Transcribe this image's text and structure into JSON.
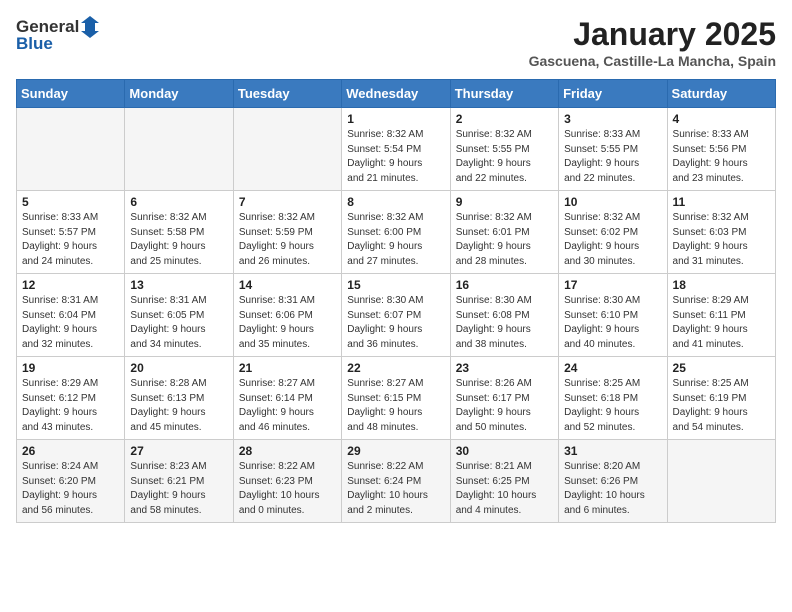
{
  "logo": {
    "text_general": "General",
    "text_blue": "Blue"
  },
  "title": {
    "month": "January 2025",
    "location": "Gascuena, Castille-La Mancha, Spain"
  },
  "headers": [
    "Sunday",
    "Monday",
    "Tuesday",
    "Wednesday",
    "Thursday",
    "Friday",
    "Saturday"
  ],
  "weeks": [
    [
      {
        "day": "",
        "info": ""
      },
      {
        "day": "",
        "info": ""
      },
      {
        "day": "",
        "info": ""
      },
      {
        "day": "1",
        "info": "Sunrise: 8:32 AM\nSunset: 5:54 PM\nDaylight: 9 hours\nand 21 minutes."
      },
      {
        "day": "2",
        "info": "Sunrise: 8:32 AM\nSunset: 5:55 PM\nDaylight: 9 hours\nand 22 minutes."
      },
      {
        "day": "3",
        "info": "Sunrise: 8:33 AM\nSunset: 5:55 PM\nDaylight: 9 hours\nand 22 minutes."
      },
      {
        "day": "4",
        "info": "Sunrise: 8:33 AM\nSunset: 5:56 PM\nDaylight: 9 hours\nand 23 minutes."
      }
    ],
    [
      {
        "day": "5",
        "info": "Sunrise: 8:33 AM\nSunset: 5:57 PM\nDaylight: 9 hours\nand 24 minutes."
      },
      {
        "day": "6",
        "info": "Sunrise: 8:32 AM\nSunset: 5:58 PM\nDaylight: 9 hours\nand 25 minutes."
      },
      {
        "day": "7",
        "info": "Sunrise: 8:32 AM\nSunset: 5:59 PM\nDaylight: 9 hours\nand 26 minutes."
      },
      {
        "day": "8",
        "info": "Sunrise: 8:32 AM\nSunset: 6:00 PM\nDaylight: 9 hours\nand 27 minutes."
      },
      {
        "day": "9",
        "info": "Sunrise: 8:32 AM\nSunset: 6:01 PM\nDaylight: 9 hours\nand 28 minutes."
      },
      {
        "day": "10",
        "info": "Sunrise: 8:32 AM\nSunset: 6:02 PM\nDaylight: 9 hours\nand 30 minutes."
      },
      {
        "day": "11",
        "info": "Sunrise: 8:32 AM\nSunset: 6:03 PM\nDaylight: 9 hours\nand 31 minutes."
      }
    ],
    [
      {
        "day": "12",
        "info": "Sunrise: 8:31 AM\nSunset: 6:04 PM\nDaylight: 9 hours\nand 32 minutes."
      },
      {
        "day": "13",
        "info": "Sunrise: 8:31 AM\nSunset: 6:05 PM\nDaylight: 9 hours\nand 34 minutes."
      },
      {
        "day": "14",
        "info": "Sunrise: 8:31 AM\nSunset: 6:06 PM\nDaylight: 9 hours\nand 35 minutes."
      },
      {
        "day": "15",
        "info": "Sunrise: 8:30 AM\nSunset: 6:07 PM\nDaylight: 9 hours\nand 36 minutes."
      },
      {
        "day": "16",
        "info": "Sunrise: 8:30 AM\nSunset: 6:08 PM\nDaylight: 9 hours\nand 38 minutes."
      },
      {
        "day": "17",
        "info": "Sunrise: 8:30 AM\nSunset: 6:10 PM\nDaylight: 9 hours\nand 40 minutes."
      },
      {
        "day": "18",
        "info": "Sunrise: 8:29 AM\nSunset: 6:11 PM\nDaylight: 9 hours\nand 41 minutes."
      }
    ],
    [
      {
        "day": "19",
        "info": "Sunrise: 8:29 AM\nSunset: 6:12 PM\nDaylight: 9 hours\nand 43 minutes."
      },
      {
        "day": "20",
        "info": "Sunrise: 8:28 AM\nSunset: 6:13 PM\nDaylight: 9 hours\nand 45 minutes."
      },
      {
        "day": "21",
        "info": "Sunrise: 8:27 AM\nSunset: 6:14 PM\nDaylight: 9 hours\nand 46 minutes."
      },
      {
        "day": "22",
        "info": "Sunrise: 8:27 AM\nSunset: 6:15 PM\nDaylight: 9 hours\nand 48 minutes."
      },
      {
        "day": "23",
        "info": "Sunrise: 8:26 AM\nSunset: 6:17 PM\nDaylight: 9 hours\nand 50 minutes."
      },
      {
        "day": "24",
        "info": "Sunrise: 8:25 AM\nSunset: 6:18 PM\nDaylight: 9 hours\nand 52 minutes."
      },
      {
        "day": "25",
        "info": "Sunrise: 8:25 AM\nSunset: 6:19 PM\nDaylight: 9 hours\nand 54 minutes."
      }
    ],
    [
      {
        "day": "26",
        "info": "Sunrise: 8:24 AM\nSunset: 6:20 PM\nDaylight: 9 hours\nand 56 minutes."
      },
      {
        "day": "27",
        "info": "Sunrise: 8:23 AM\nSunset: 6:21 PM\nDaylight: 9 hours\nand 58 minutes."
      },
      {
        "day": "28",
        "info": "Sunrise: 8:22 AM\nSunset: 6:23 PM\nDaylight: 10 hours\nand 0 minutes."
      },
      {
        "day": "29",
        "info": "Sunrise: 8:22 AM\nSunset: 6:24 PM\nDaylight: 10 hours\nand 2 minutes."
      },
      {
        "day": "30",
        "info": "Sunrise: 8:21 AM\nSunset: 6:25 PM\nDaylight: 10 hours\nand 4 minutes."
      },
      {
        "day": "31",
        "info": "Sunrise: 8:20 AM\nSunset: 6:26 PM\nDaylight: 10 hours\nand 6 minutes."
      },
      {
        "day": "",
        "info": ""
      }
    ]
  ]
}
